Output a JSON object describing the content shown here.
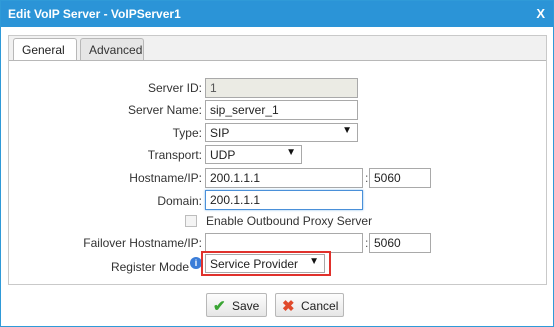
{
  "dialog": {
    "title": "Edit VoIP Server - VoIPServer1",
    "close_label": "X"
  },
  "tabs": [
    {
      "label": "General",
      "active": true
    },
    {
      "label": "Advanced",
      "active": false
    }
  ],
  "form": {
    "server_id": {
      "label": "Server ID:",
      "value": "1"
    },
    "server_name": {
      "label": "Server Name:",
      "value": "sip_server_1"
    },
    "type": {
      "label": "Type:",
      "value": "SIP"
    },
    "transport": {
      "label": "Transport:",
      "value": "UDP"
    },
    "hostname": {
      "label": "Hostname/IP:",
      "value": "200.1.1.1",
      "separator": ":",
      "port": "5060"
    },
    "domain": {
      "label": "Domain:",
      "value": "200.1.1.1"
    },
    "outbound_proxy": {
      "label": "Enable Outbound Proxy Server",
      "checked": false
    },
    "failover": {
      "label": "Failover Hostname/IP:",
      "value": "",
      "separator": ":",
      "port": "5060"
    },
    "register_mode": {
      "label": "Register Mode",
      "value": "Service Provider",
      "info_icon": "i"
    }
  },
  "buttons": {
    "save": "Save",
    "cancel": "Cancel"
  },
  "colors": {
    "titlebar": "#2b94d7",
    "highlight": "#e0312c",
    "save_icon": "#3aa534",
    "cancel_icon": "#e04a2c"
  }
}
